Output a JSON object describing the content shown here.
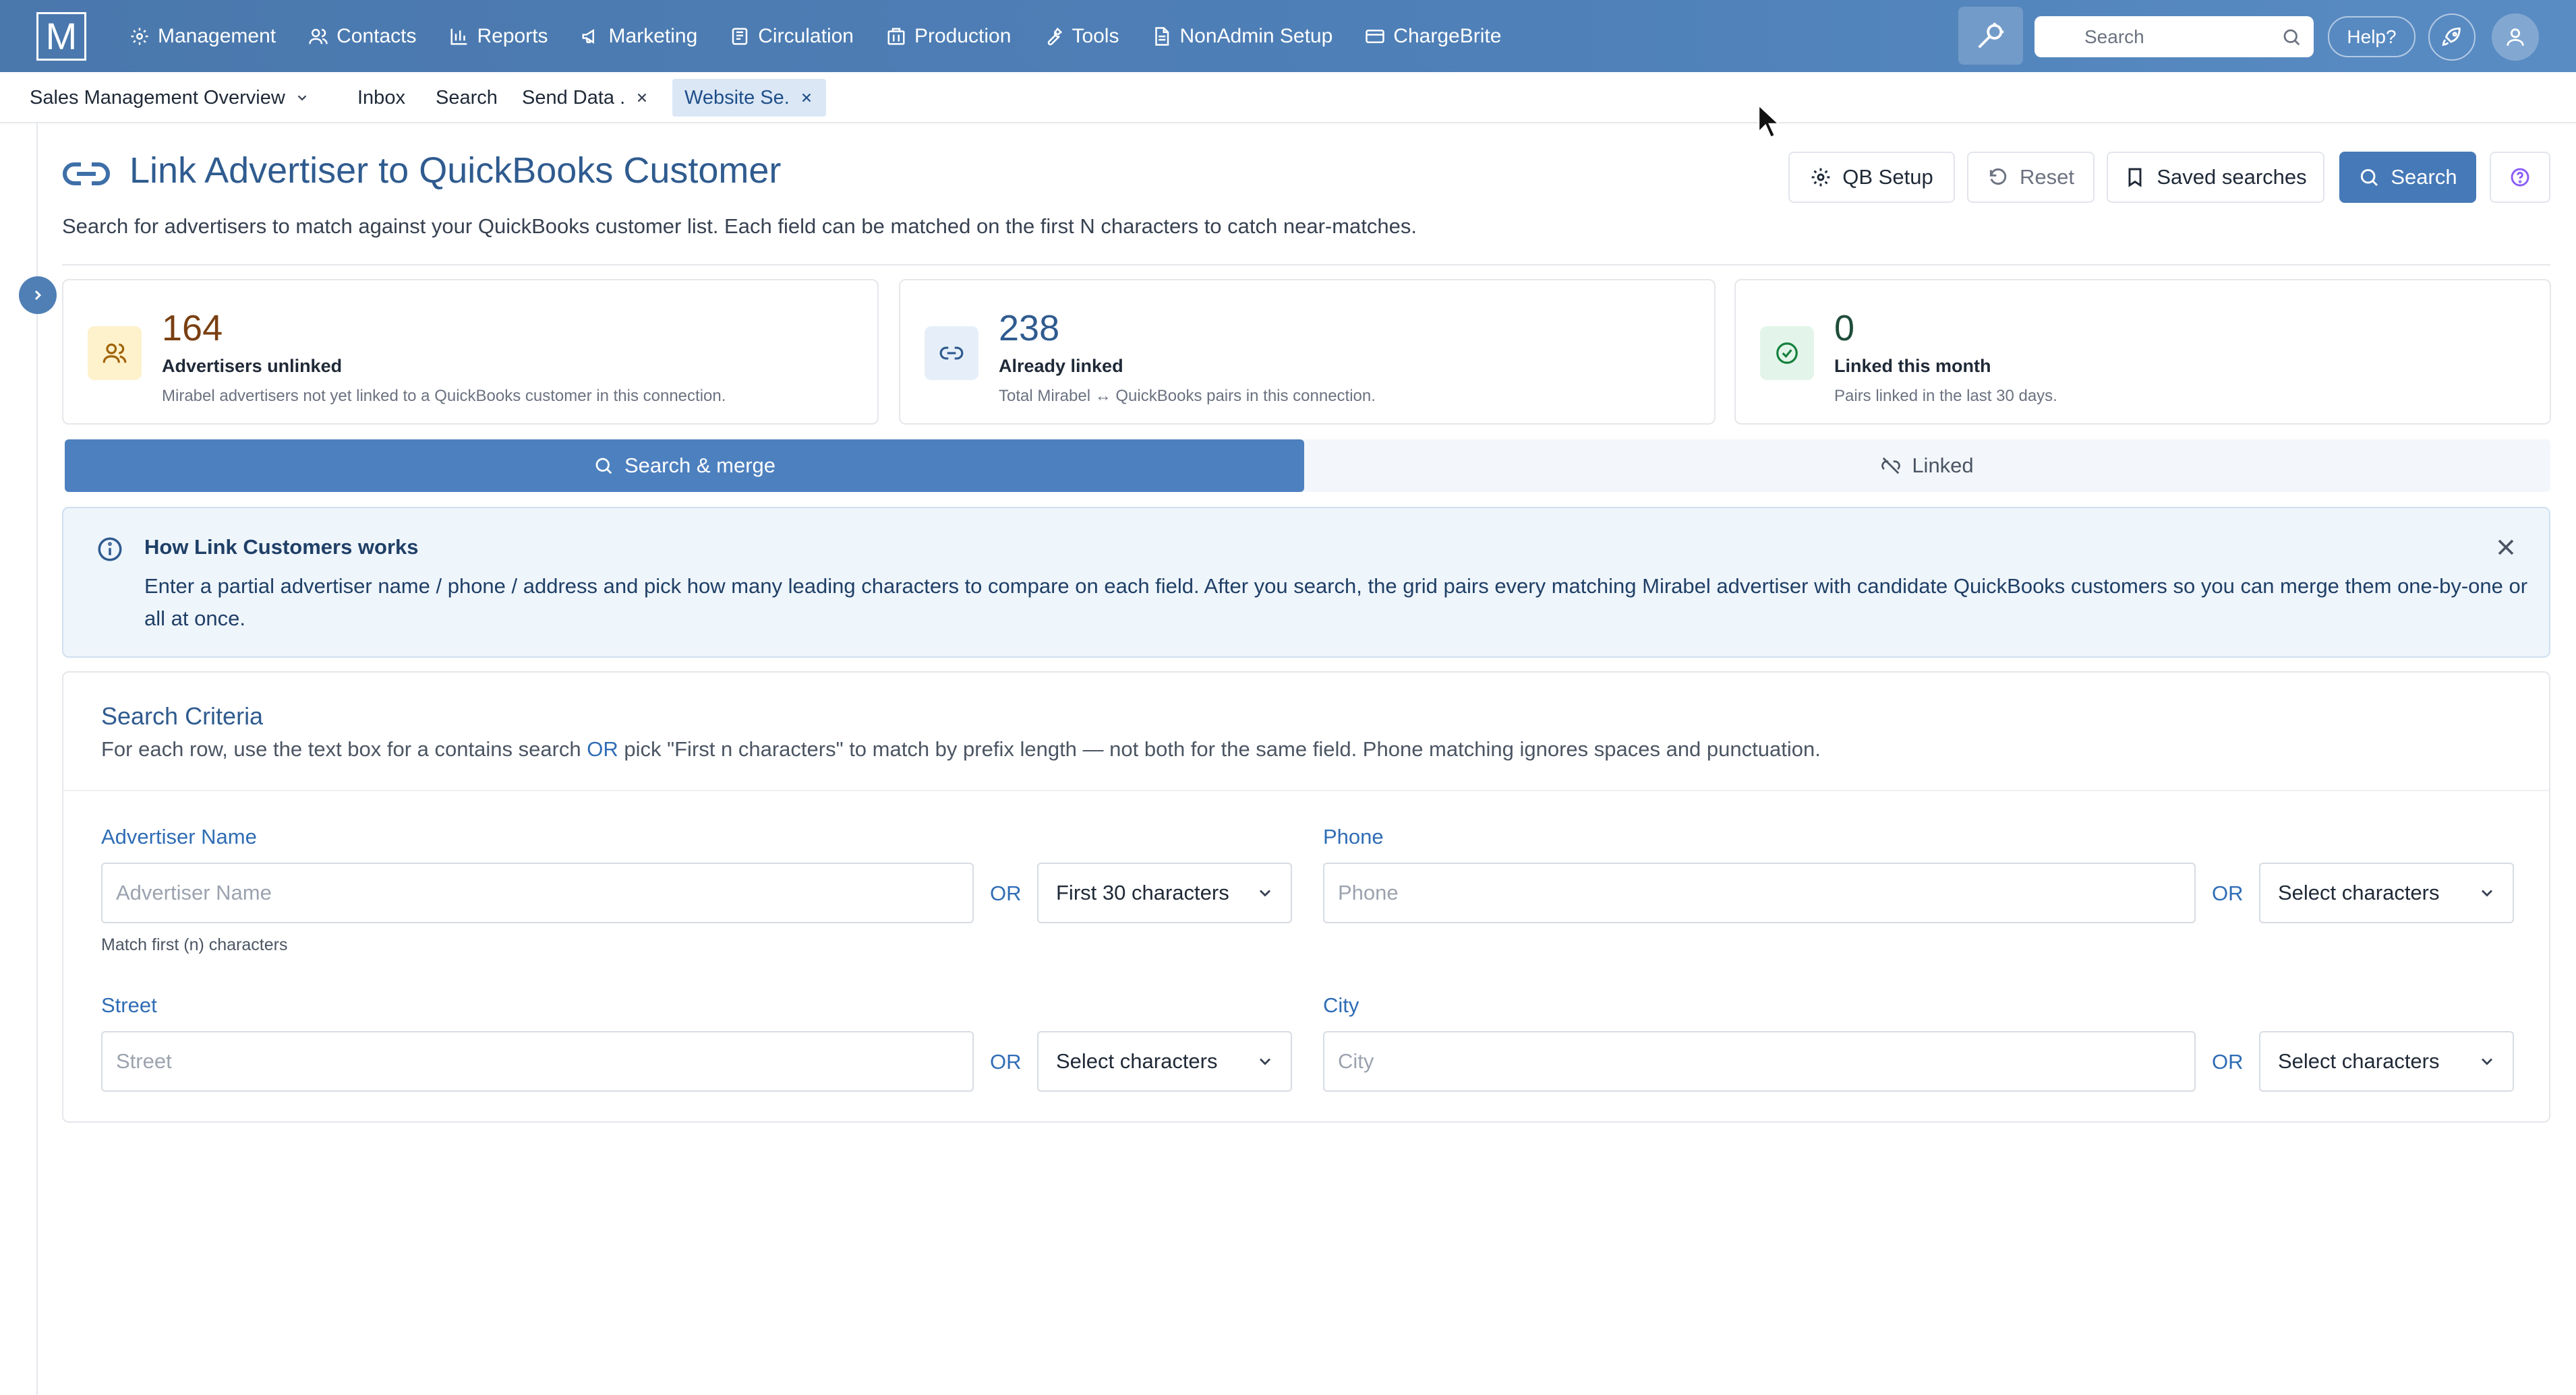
{
  "app": {
    "logo_letter": "M",
    "nav": [
      {
        "label": "Management",
        "icon": "gear-icon"
      },
      {
        "label": "Contacts",
        "icon": "contacts-icon"
      },
      {
        "label": "Reports",
        "icon": "bar-chart-icon"
      },
      {
        "label": "Marketing",
        "icon": "megaphone-icon"
      },
      {
        "label": "Circulation",
        "icon": "newspaper-icon"
      },
      {
        "label": "Production",
        "icon": "building-icon"
      },
      {
        "label": "Tools",
        "icon": "wrench-icon"
      },
      {
        "label": "NonAdmin Setup",
        "icon": "document-icon"
      },
      {
        "label": "ChargeBrite",
        "icon": "credit-card-icon"
      }
    ],
    "search_placeholder": "Search",
    "help_label": "Help?"
  },
  "tabs": [
    {
      "label": "Sales Management Overview",
      "has_dropdown": true
    },
    {
      "label": "Inbox"
    },
    {
      "label": "Search"
    },
    {
      "label": "Send Data .",
      "closable": true
    },
    {
      "label": "Website Se.",
      "closable": true,
      "active": true
    }
  ],
  "header": {
    "title": "Link Advertiser to QuickBooks Customer",
    "subtitle": "Search for advertisers to match against your QuickBooks customer list. Each field can be matched on the first N characters to catch near-matches.",
    "buttons": {
      "qb_setup": "QB Setup",
      "reset": "Reset",
      "saved_searches": "Saved searches",
      "search": "Search"
    }
  },
  "stats": [
    {
      "value": "164",
      "label": "Advertisers unlinked",
      "desc": "Mirabel advertisers not yet linked to a QuickBooks customer in this connection.",
      "color": "#7a3f12",
      "icon_bg": "#fdf2cc",
      "icon_stroke": "#a16207"
    },
    {
      "value": "238",
      "label": "Already linked",
      "desc": "Total Mirabel ↔ QuickBooks pairs in this connection.",
      "color": "#2f5b8f",
      "icon_bg": "#e6eff9",
      "icon_stroke": "#2f5b8f"
    },
    {
      "value": "0",
      "label": "Linked this month",
      "desc": "Pairs linked in the last 30 days.",
      "color": "#1f4d3a",
      "icon_bg": "#e3f5ea",
      "icon_stroke": "#15803d"
    }
  ],
  "segments": {
    "search_merge": "Search & merge",
    "linked": "Linked"
  },
  "info": {
    "title": "How Link Customers works",
    "text": "Enter a partial advertiser name / phone / address and pick how many leading characters to compare on each field. After you search, the grid pairs every matching Mirabel advertiser with candidate QuickBooks customers so you can merge them one-by-one or all at once."
  },
  "criteria": {
    "title": "Search Criteria",
    "desc_before": "For each row, use the text box for a contains search ",
    "desc_or": "OR",
    "desc_after": " pick \"First n characters\" to match by prefix length — not both for the same field. Phone matching ignores spaces and punctuation.",
    "or_label": "OR",
    "fields": {
      "advertiser_name": {
        "label": "Advertiser Name",
        "placeholder": "Advertiser Name",
        "select": "First 30 characters",
        "hint": "Match first (n) characters"
      },
      "phone": {
        "label": "Phone",
        "placeholder": "Phone",
        "select": "Select characters"
      },
      "street": {
        "label": "Street",
        "placeholder": "Street",
        "select": "Select characters"
      },
      "city": {
        "label": "City",
        "placeholder": "City",
        "select": "Select characters"
      }
    }
  },
  "colors": {
    "nav_bg": "#4f80b8",
    "primary": "#4679b7",
    "accent_text": "#2f6db5"
  }
}
